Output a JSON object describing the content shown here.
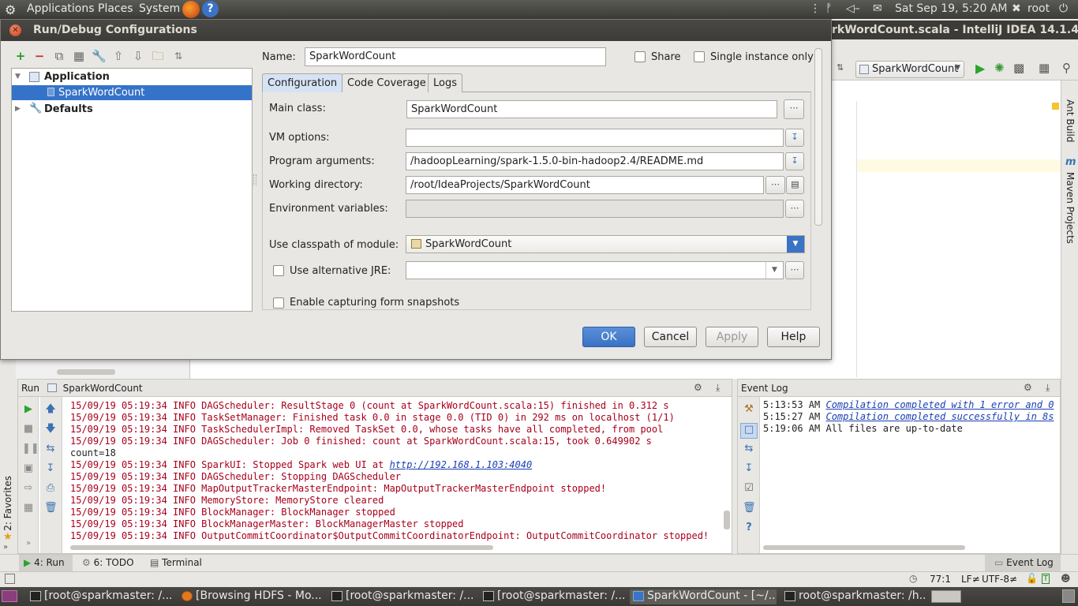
{
  "top_panel": {
    "menus": [
      "Applications",
      "Places",
      "System"
    ],
    "clock": "Sat Sep 19,  5:20 AM",
    "user": "root"
  },
  "ide": {
    "title": "rkWordCount.scala - IntelliJ IDEA 14.1.4",
    "run_config": "SparkWordCount",
    "right_tools": [
      "Ant Build",
      "Maven Projects"
    ],
    "left_tools": [
      "2: Favorites"
    ]
  },
  "dialog": {
    "title": "Run/Debug Configurations",
    "tree": {
      "application": "Application",
      "item": "SparkWordCount",
      "defaults": "Defaults"
    },
    "name_label": "Name:",
    "name_value": "SparkWordCount",
    "share_label": "Share",
    "single_instance_label": "Single instance only",
    "tabs": [
      "Configuration",
      "Code Coverage",
      "Logs"
    ],
    "fields": {
      "main_class_label": "Main class:",
      "main_class_value": "SparkWordCount",
      "vm_options_label": "VM options:",
      "vm_options_value": "",
      "program_args_label": "Program arguments:",
      "program_args_value": "/hadoopLearning/spark-1.5.0-bin-hadoop2.4/README.md",
      "working_dir_label": "Working directory:",
      "working_dir_value": "/root/IdeaProjects/SparkWordCount",
      "env_vars_label": "Environment variables:",
      "env_vars_value": "",
      "classpath_label": "Use classpath of module:",
      "classpath_value": "SparkWordCount",
      "alt_jre_label": "Use alternative JRE:",
      "snapshots_label": "Enable capturing form snapshots"
    },
    "buttons": {
      "ok": "OK",
      "cancel": "Cancel",
      "apply": "Apply",
      "help": "Help"
    }
  },
  "run_panel": {
    "header_prefix": "Run",
    "header_config": "SparkWordCount",
    "lines": [
      {
        "text": "15/09/19 05:19:34 INFO DAGScheduler: ResultStage 0 (count at SparkWordCount.scala:15) finished in 0.312 s",
        "kind": "err"
      },
      {
        "text": "15/09/19 05:19:34 INFO TaskSetManager: Finished task 0.0 in stage 0.0 (TID 0) in 292 ms on localhost (1/1)",
        "kind": "err"
      },
      {
        "text": "15/09/19 05:19:34 INFO TaskSchedulerImpl: Removed TaskSet 0.0, whose tasks have all completed, from pool",
        "kind": "err"
      },
      {
        "text": "15/09/19 05:19:34 INFO DAGScheduler: Job 0 finished: count at SparkWordCount.scala:15, took 0.649902 s",
        "kind": "err"
      },
      {
        "text": "count=18",
        "kind": "plain"
      },
      {
        "text": "15/09/19 05:19:34 INFO SparkUI: Stopped Spark web UI at ",
        "kind": "err",
        "link": "http://192.168.1.103:4040"
      },
      {
        "text": "15/09/19 05:19:34 INFO DAGScheduler: Stopping DAGScheduler",
        "kind": "err"
      },
      {
        "text": "15/09/19 05:19:34 INFO MapOutputTrackerMasterEndpoint: MapOutputTrackerMasterEndpoint stopped!",
        "kind": "err"
      },
      {
        "text": "15/09/19 05:19:34 INFO MemoryStore: MemoryStore cleared",
        "kind": "err"
      },
      {
        "text": "15/09/19 05:19:34 INFO BlockManager: BlockManager stopped",
        "kind": "err"
      },
      {
        "text": "15/09/19 05:19:34 INFO BlockManagerMaster: BlockManagerMaster stopped",
        "kind": "err"
      },
      {
        "text": "15/09/19 05:19:34 INFO OutputCommitCoordinator$OutputCommitCoordinatorEndpoint: OutputCommitCoordinator stopped!",
        "kind": "err"
      }
    ]
  },
  "event_log": {
    "title": "Event Log",
    "entries": [
      {
        "time": "5:13:53 AM",
        "text": "Compilation completed with 1 error and 0",
        "link": true
      },
      {
        "time": "5:15:27 AM",
        "text": "Compilation completed successfully in 8s",
        "link": true
      },
      {
        "time": "5:19:06 AM",
        "text": "All files are up-to-date",
        "link": false
      }
    ]
  },
  "toolwindow_bar": {
    "run": "4: Run",
    "todo": "6: TODO",
    "terminal": "Terminal",
    "event_log": "Event Log"
  },
  "status_bar": {
    "position": "77:1",
    "line_sep": "LF≠",
    "encoding": "UTF-8≠"
  },
  "taskbar": [
    "[root@sparkmaster: /...",
    "[Browsing HDFS - Mo...",
    "[root@sparkmaster: /...",
    "[root@sparkmaster: /...",
    "SparkWordCount - [~/...",
    "root@sparkmaster: /h..."
  ]
}
